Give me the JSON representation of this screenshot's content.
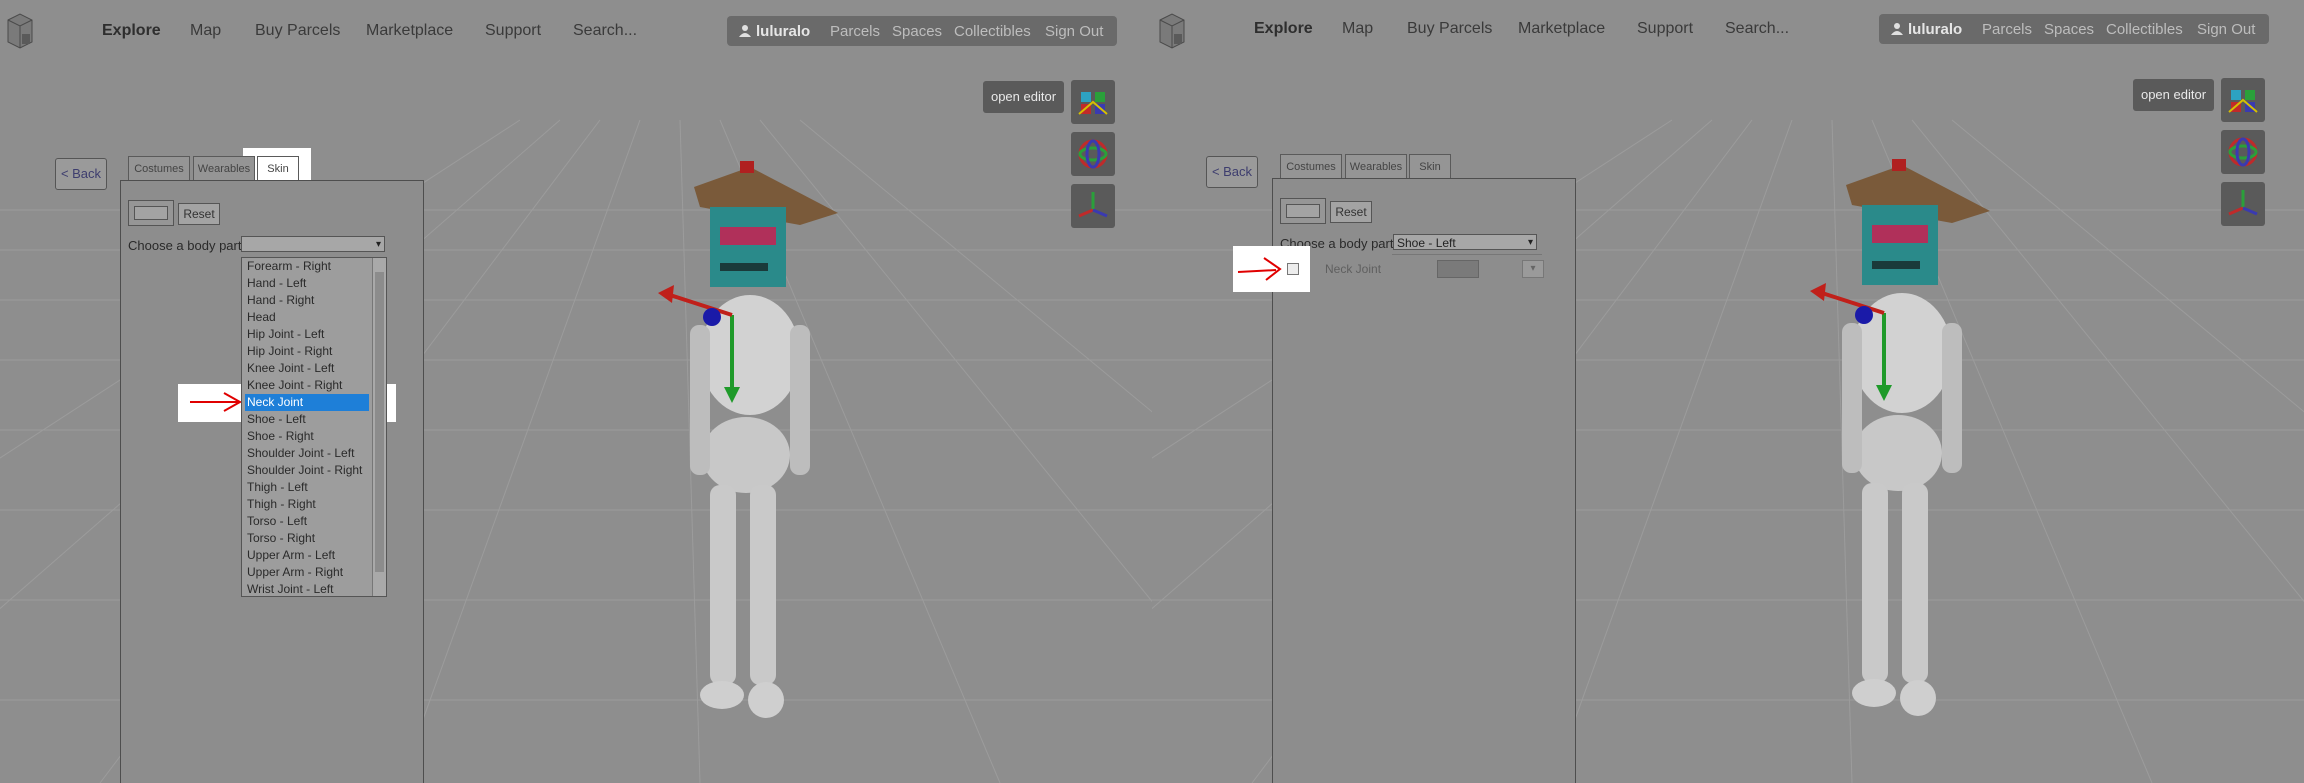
{
  "nav": {
    "items": [
      "Explore",
      "Map",
      "Buy Parcels",
      "Marketplace",
      "Support",
      "Search..."
    ]
  },
  "userbar": {
    "username": "luluralo",
    "links": [
      "Parcels",
      "Spaces",
      "Collectibles",
      "Sign Out"
    ]
  },
  "editor": {
    "open_label": "open editor",
    "back_label": "< Back",
    "tabs": [
      "Costumes",
      "Wearables",
      "Skin"
    ],
    "active_tab": "Skin",
    "reset_label": "Reset",
    "body_part_label": "Choose a body part"
  },
  "left": {
    "select_value": "",
    "dropdown_options": [
      "Forearm - Right",
      "Hand - Left",
      "Hand - Right",
      "Head",
      "Hip Joint - Left",
      "Hip Joint - Right",
      "Knee Joint - Left",
      "Knee Joint - Right",
      "Neck Joint",
      "Shoe - Left",
      "Shoe - Right",
      "Shoulder Joint - Left",
      "Shoulder Joint - Right",
      "Thigh - Left",
      "Thigh - Right",
      "Torso - Left",
      "Torso - Right",
      "Upper Arm - Left",
      "Upper Arm - Right",
      "Wrist Joint - Left"
    ],
    "selected_option": "Neck Joint"
  },
  "right": {
    "select_value": "Shoe - Left",
    "skin_row": {
      "label": "Neck Joint",
      "checked": false,
      "button": "▾"
    }
  },
  "colors": {
    "highlight": "#ffffff",
    "selected": "#1e7fd8",
    "annotation_arrow": "#e00000",
    "gizmo_x": "#c0201a",
    "gizmo_y": "#1f9a2a",
    "gizmo_z": "#1a1aa8"
  },
  "icons": {
    "logo": "voxels-logo-icon",
    "user": "user-icon",
    "gizmo_move": "move-gizmo-icon",
    "gizmo_rotate": "rotate-gizmo-icon",
    "gizmo_axes": "axes-gizmo-icon",
    "annotation": "red-arrow-icon"
  }
}
